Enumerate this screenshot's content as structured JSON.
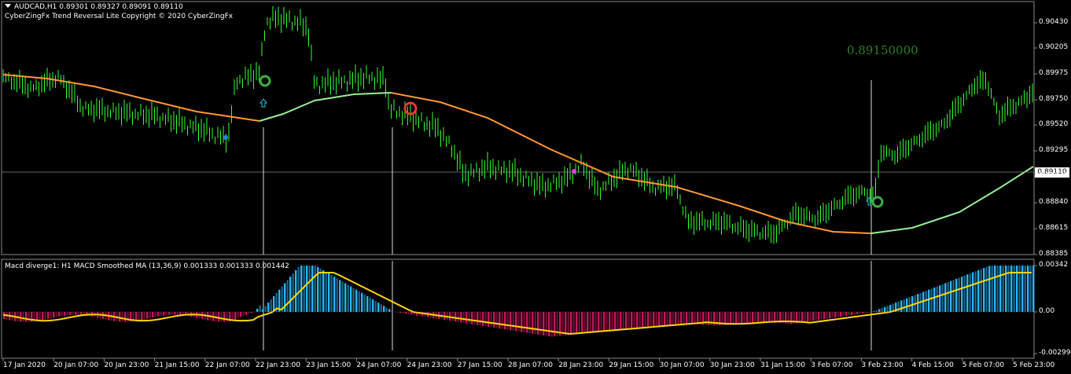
{
  "header": {
    "symbol_line": "AUDCAD,H1  0.89301 0.89327 0.89091 0.89110",
    "indicator_line": "CyberZingFx Trend Reversal Lite Copyright © 2020 CyberZingFx"
  },
  "macd_header": "Macd diverge1:  H1 MACD Smoothed MA (13,36,9) 0.001333 0.001333 0.001442",
  "current_price": "0.89110",
  "annotation_price": "0.89150000",
  "price_ticks": [
    "0.90430",
    "0.90205",
    "0.89975",
    "0.89750",
    "0.89520",
    "0.89295",
    "0.89070",
    "0.88840",
    "0.88615",
    "0.88385"
  ],
  "macd_ticks": [
    "0.00342",
    "0.00",
    "-0.002994"
  ],
  "time_ticks": [
    "17 Jan 2020",
    "20 Jan 07:00",
    "20 Jan 23:00",
    "21 Jan 15:00",
    "22 Jan 07:00",
    "22 Jan 23:00",
    "23 Jan 15:00",
    "24 Jan 07:00",
    "24 Jan 23:00",
    "27 Jan 15:00",
    "28 Jan 07:00",
    "28 Jan 23:00",
    "29 Jan 15:00",
    "30 Jan 07:00",
    "30 Jan 23:00",
    "31 Jan 15:00",
    "3 Feb 07:00",
    "3 Feb 23:00",
    "4 Feb 15:00",
    "5 Feb 07:00",
    "5 Feb 23:00"
  ],
  "colors": {
    "candles": "#33ff33",
    "ma_orange": "#ff9933",
    "ma_lightgreen": "#99ee99",
    "macd_pos": "#29b6f6",
    "macd_neg": "#c2185b",
    "signal": "#ffd700",
    "grid": "#777777"
  },
  "chart_data": {
    "type": "line",
    "x": [
      "17 Jan 2020",
      "20 Jan 07:00",
      "20 Jan 23:00",
      "21 Jan 15:00",
      "22 Jan 07:00",
      "22 Jan 23:00",
      "23 Jan 15:00",
      "24 Jan 07:00",
      "24 Jan 23:00",
      "27 Jan 15:00",
      "28 Jan 07:00",
      "28 Jan 23:00",
      "29 Jan 15:00",
      "30 Jan 07:00",
      "30 Jan 23:00",
      "31 Jan 15:00",
      "3 Feb 07:00",
      "3 Feb 23:00",
      "4 Feb 15:00",
      "5 Feb 07:00",
      "5 Feb 23:00"
    ],
    "series": [
      {
        "name": "AUDCAD,H1",
        "values": [
          0.8998,
          0.8992,
          0.8965,
          0.8958,
          0.894,
          0.904,
          0.9,
          0.899,
          0.8953,
          0.891,
          0.89,
          0.8907,
          0.891,
          0.8892,
          0.8865,
          0.8863,
          0.887,
          0.8885,
          0.8935,
          0.8965,
          0.8975
        ]
      }
    ],
    "ylim": [
      0.88385,
      0.9043
    ]
  }
}
